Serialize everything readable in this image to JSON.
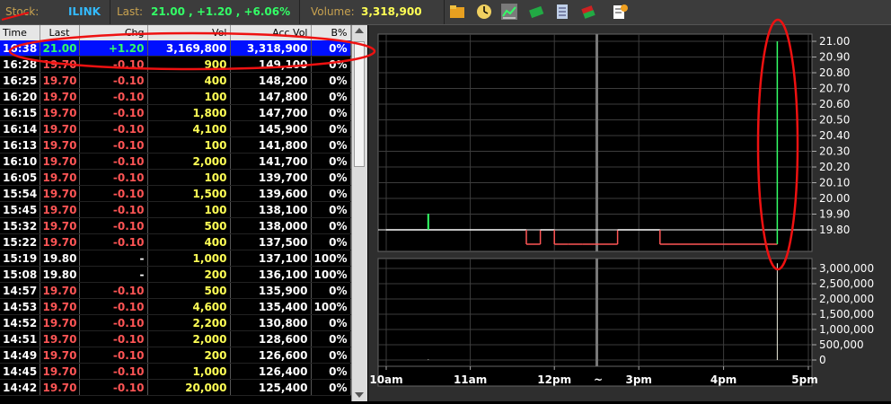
{
  "topbar": {
    "stock_label": "Stock:",
    "stock_value": "ILINK",
    "last_label": "Last:",
    "last_value": "21.00 , +1.20 , +6.06%",
    "volume_label": "Volume:",
    "volume_value": "3,318,900",
    "icons": [
      "folder-icon",
      "clock-icon",
      "chart-icon",
      "money-icon",
      "document-icon",
      "transfer-icon",
      "notes-icon"
    ]
  },
  "table": {
    "headers": [
      "Time",
      "Last",
      "Chg",
      "Vol",
      "Acc Vol",
      "B%"
    ],
    "rows": [
      {
        "time": "16:38",
        "last": "21.00",
        "chg": "+1.20",
        "vol": "3,169,800",
        "acc": "3,318,900",
        "b": "0%",
        "color": "green",
        "selected": true
      },
      {
        "time": "16:28",
        "last": "19.70",
        "chg": "-0.10",
        "vol": "900",
        "acc": "149,100",
        "b": "0%",
        "color": "red"
      },
      {
        "time": "16:25",
        "last": "19.70",
        "chg": "-0.10",
        "vol": "400",
        "acc": "148,200",
        "b": "0%",
        "color": "red"
      },
      {
        "time": "16:20",
        "last": "19.70",
        "chg": "-0.10",
        "vol": "100",
        "acc": "147,800",
        "b": "0%",
        "color": "red"
      },
      {
        "time": "16:15",
        "last": "19.70",
        "chg": "-0.10",
        "vol": "1,800",
        "acc": "147,700",
        "b": "0%",
        "color": "red"
      },
      {
        "time": "16:14",
        "last": "19.70",
        "chg": "-0.10",
        "vol": "4,100",
        "acc": "145,900",
        "b": "0%",
        "color": "red"
      },
      {
        "time": "16:13",
        "last": "19.70",
        "chg": "-0.10",
        "vol": "100",
        "acc": "141,800",
        "b": "0%",
        "color": "red"
      },
      {
        "time": "16:10",
        "last": "19.70",
        "chg": "-0.10",
        "vol": "2,000",
        "acc": "141,700",
        "b": "0%",
        "color": "red"
      },
      {
        "time": "16:05",
        "last": "19.70",
        "chg": "-0.10",
        "vol": "100",
        "acc": "139,700",
        "b": "0%",
        "color": "red"
      },
      {
        "time": "15:54",
        "last": "19.70",
        "chg": "-0.10",
        "vol": "1,500",
        "acc": "139,600",
        "b": "0%",
        "color": "red"
      },
      {
        "time": "15:45",
        "last": "19.70",
        "chg": "-0.10",
        "vol": "100",
        "acc": "138,100",
        "b": "0%",
        "color": "red"
      },
      {
        "time": "15:32",
        "last": "19.70",
        "chg": "-0.10",
        "vol": "500",
        "acc": "138,000",
        "b": "0%",
        "color": "red"
      },
      {
        "time": "15:22",
        "last": "19.70",
        "chg": "-0.10",
        "vol": "400",
        "acc": "137,500",
        "b": "0%",
        "color": "red"
      },
      {
        "time": "15:19",
        "last": "19.80",
        "chg": "-",
        "vol": "1,000",
        "acc": "137,100",
        "b": "100%",
        "color": "white"
      },
      {
        "time": "15:08",
        "last": "19.80",
        "chg": "-",
        "vol": "200",
        "acc": "136,100",
        "b": "100%",
        "color": "white"
      },
      {
        "time": "14:57",
        "last": "19.70",
        "chg": "-0.10",
        "vol": "500",
        "acc": "135,900",
        "b": "0%",
        "color": "red"
      },
      {
        "time": "14:53",
        "last": "19.70",
        "chg": "-0.10",
        "vol": "4,600",
        "acc": "135,400",
        "b": "100%",
        "color": "red"
      },
      {
        "time": "14:52",
        "last": "19.70",
        "chg": "-0.10",
        "vol": "2,200",
        "acc": "130,800",
        "b": "0%",
        "color": "red"
      },
      {
        "time": "14:51",
        "last": "19.70",
        "chg": "-0.10",
        "vol": "2,000",
        "acc": "128,600",
        "b": "0%",
        "color": "red"
      },
      {
        "time": "14:49",
        "last": "19.70",
        "chg": "-0.10",
        "vol": "200",
        "acc": "126,600",
        "b": "0%",
        "color": "red"
      },
      {
        "time": "14:45",
        "last": "19.70",
        "chg": "-0.10",
        "vol": "1,000",
        "acc": "126,400",
        "b": "0%",
        "color": "red"
      },
      {
        "time": "14:42",
        "last": "19.70",
        "chg": "-0.10",
        "vol": "20,000",
        "acc": "125,400",
        "b": "0%",
        "color": "red"
      }
    ]
  },
  "chart": {
    "price_ticks": [
      "21.00",
      "20.90",
      "20.80",
      "20.70",
      "20.60",
      "20.50",
      "20.40",
      "20.30",
      "20.20",
      "20.10",
      "20.00",
      "19.90",
      "19.80"
    ],
    "volume_ticks": [
      "3,000,000",
      "2,500,000",
      "2,000,000",
      "1,500,000",
      "1,000,000",
      "500,000",
      "0"
    ],
    "time_ticks": [
      "10am",
      "11am",
      "12pm",
      "~",
      "3pm",
      "4pm",
      "5pm"
    ],
    "colors": {
      "up": "#33ff66",
      "down": "#ff5555",
      "flat": "#ffffff",
      "grid": "#3d3d3d",
      "annotation": "#ee1111"
    }
  },
  "chart_data": {
    "type": "line",
    "price": {
      "x": [
        "10:00",
        "10:30",
        "11:00",
        "11:30",
        "11:40",
        "11:50",
        "12:00",
        "12:10",
        "12:20",
        "14:30",
        "14:45",
        "15:00",
        "15:15",
        "16:00",
        "16:30",
        "16:38"
      ],
      "y": [
        19.8,
        19.8,
        19.8,
        19.8,
        19.7,
        19.8,
        19.7,
        19.7,
        19.7,
        19.7,
        19.8,
        19.8,
        19.7,
        19.7,
        19.7,
        21.0
      ]
    },
    "volume": {
      "x": [
        "10:30",
        "16:38"
      ],
      "values": [
        20000,
        3169800
      ]
    },
    "ylim_price": [
      19.8,
      21.0
    ],
    "ylim_volume": [
      0,
      3000000
    ],
    "xlabel": "",
    "ylabel": "",
    "grid": true
  }
}
